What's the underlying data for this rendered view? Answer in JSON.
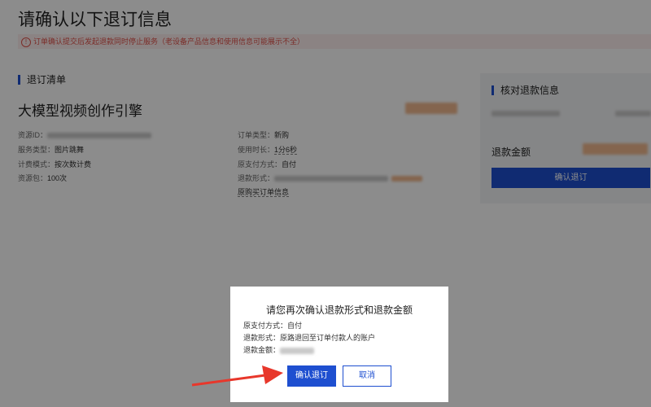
{
  "header": {
    "title": "请确认以下退订信息",
    "notice": "订单确认提交后发起退款同时停止服务（老设备产品信息和使用信息可能展示不全）"
  },
  "order": {
    "section_title": "退订清单",
    "product_name": "大模型视频创作引擎",
    "left_fields": [
      {
        "key": "资源ID：",
        "value": ""
      },
      {
        "key": "服务类型：",
        "value": "图片跳舞"
      },
      {
        "key": "计费模式：",
        "value": "按次数计费"
      },
      {
        "key": "资源包：",
        "value": "100次"
      }
    ],
    "right_fields": [
      {
        "key": "订单类型：",
        "value": "新购"
      },
      {
        "key": "使用时长：",
        "value": "1分6秒"
      },
      {
        "key": "原支付方式：",
        "value": "自付"
      },
      {
        "key": "退款形式：",
        "value": ""
      }
    ],
    "purchase_link": "原购买订单信息"
  },
  "refund_panel": {
    "section_title": "核对退款信息",
    "amount_label": "退款金额",
    "confirm_label": "确认退订"
  },
  "dialog": {
    "title": "请您再次确认退款形式和退款金额",
    "lines": [
      "原支付方式：自付",
      "退款形式：原路退回至订单付款人的账户",
      "退款金额："
    ],
    "ok_label": "确认退订",
    "cancel_label": "取消"
  },
  "colors": {
    "accent": "#1e4fd0",
    "warning": "#e0534b",
    "arrow": "#e8372b"
  }
}
